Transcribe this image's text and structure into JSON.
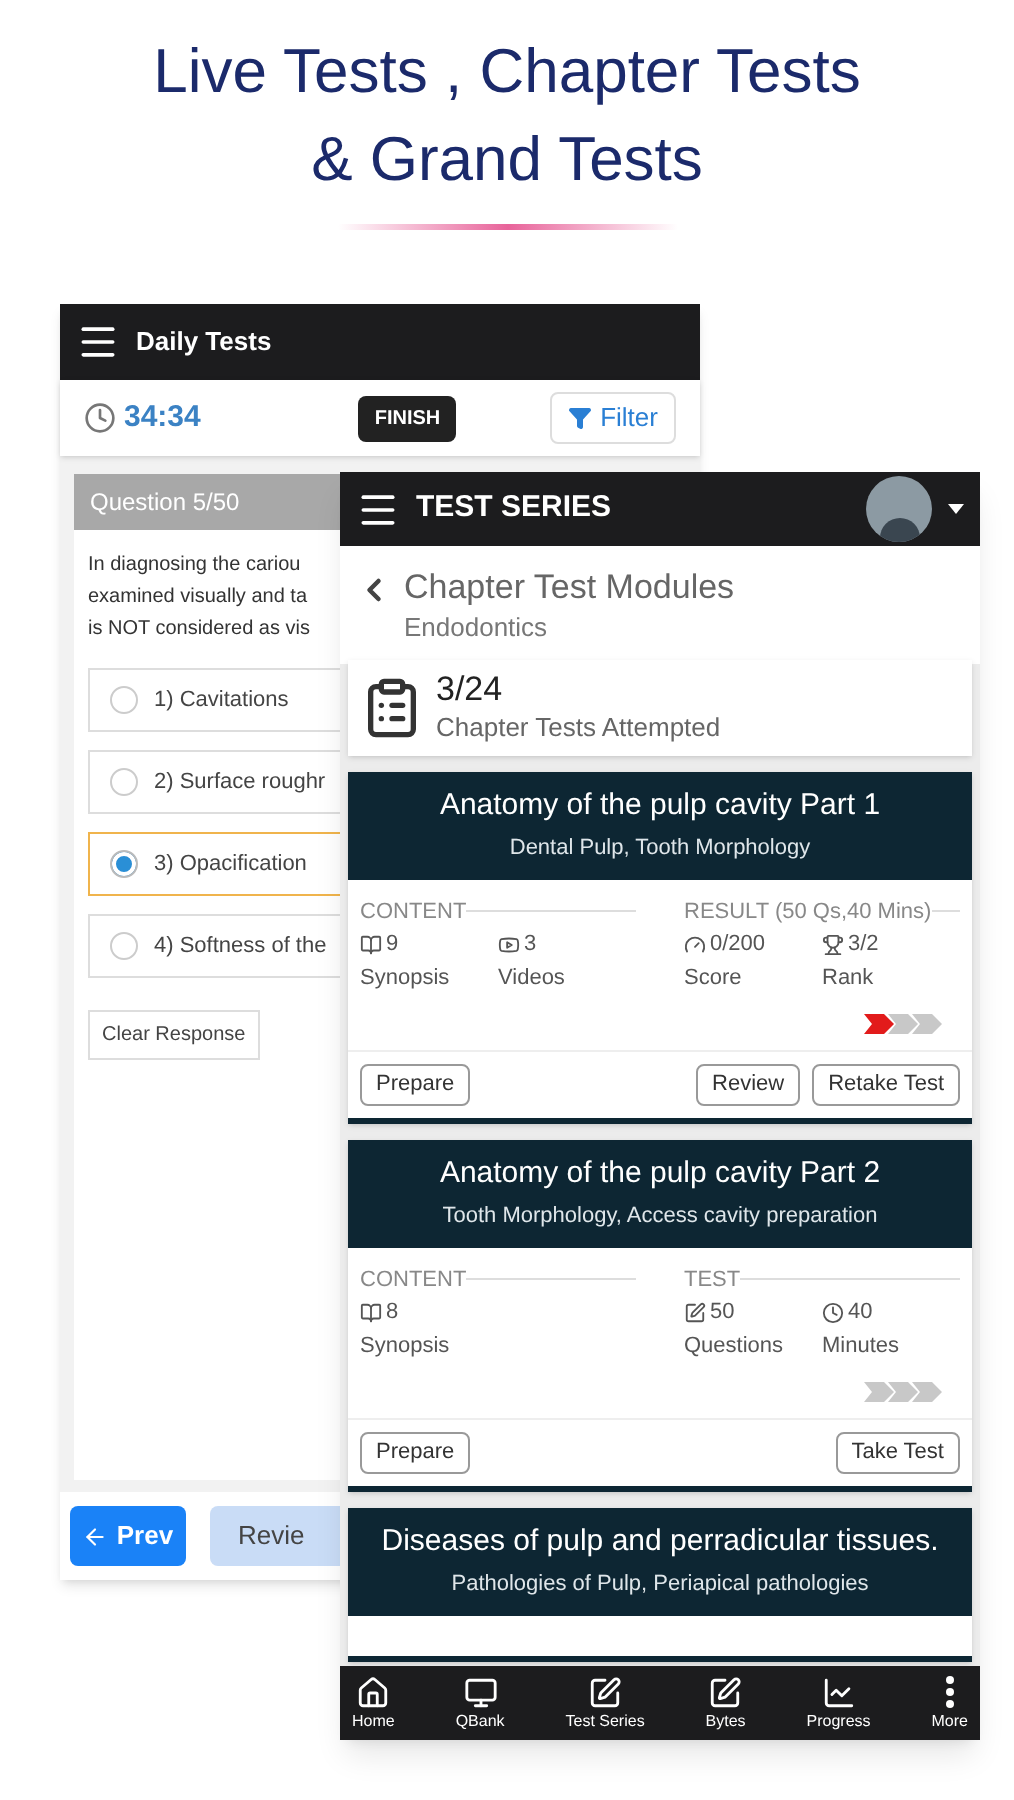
{
  "headline": [
    "Live Tests , Chapter Tests",
    "& Grand Tests"
  ],
  "daily": {
    "title": "Daily Tests",
    "timer": "34:34",
    "finish": "FINISH",
    "filter": "Filter",
    "question_no": "Question 5/50",
    "question_lines": [
      "In diagnosing the cariou",
      "examined visually and ta",
      "is NOT considered as vis"
    ],
    "options": [
      {
        "label": "1) Cavitations",
        "selected": false
      },
      {
        "label": "2) Surface roughr",
        "selected": false
      },
      {
        "label": "3) Opacification",
        "selected": true
      },
      {
        "label": "4) Softness of the",
        "selected": false
      }
    ],
    "clear": "Clear Response",
    "prev": "Prev",
    "review": "Revie"
  },
  "series": {
    "title": "TEST SERIES",
    "page_title": "Chapter Test Modules",
    "page_subtitle": "Endodontics",
    "attempted": {
      "value": "3/24",
      "label": "Chapter Tests Attempted"
    },
    "cards": [
      {
        "title": "Anatomy of the pulp cavity Part 1",
        "subtitle": "Dental Pulp, Tooth Morphology",
        "sections": [
          {
            "label": "CONTENT",
            "items": [
              {
                "count": "9",
                "label": "Synopsis"
              },
              {
                "count": "3",
                "label": "Videos"
              }
            ]
          },
          {
            "label": "RESULT (50 Qs,40 Mins)",
            "items": [
              {
                "count": "0/200",
                "label": "Score"
              },
              {
                "count": "3/2",
                "label": "Rank"
              }
            ]
          }
        ],
        "steps": [
          {
            "done": true
          },
          {
            "done": false
          },
          {
            "done": false
          }
        ],
        "buttons": [
          "Prepare",
          "Review",
          "Retake Test"
        ]
      },
      {
        "title": "Anatomy of the pulp cavity Part 2",
        "subtitle": "Tooth Morphology, Access cavity preparation",
        "sections": [
          {
            "label": "CONTENT",
            "items": [
              {
                "count": "8",
                "label": "Synopsis"
              }
            ]
          },
          {
            "label": "TEST",
            "items": [
              {
                "count": "50",
                "label": "Questions"
              },
              {
                "count": "40",
                "label": "Minutes"
              }
            ]
          }
        ],
        "steps": [
          {
            "done": false
          },
          {
            "done": false
          },
          {
            "done": false
          }
        ],
        "buttons": [
          "Prepare",
          "Take Test"
        ]
      },
      {
        "title": "Diseases of pulp and perradicular tissues.",
        "subtitle": "Pathologies of Pulp, Periapical pathologies"
      }
    ],
    "nav": [
      {
        "label": "Home"
      },
      {
        "label": "QBank"
      },
      {
        "label": "Test Series"
      },
      {
        "label": "Bytes"
      },
      {
        "label": "Progress"
      },
      {
        "label": "More"
      }
    ]
  }
}
